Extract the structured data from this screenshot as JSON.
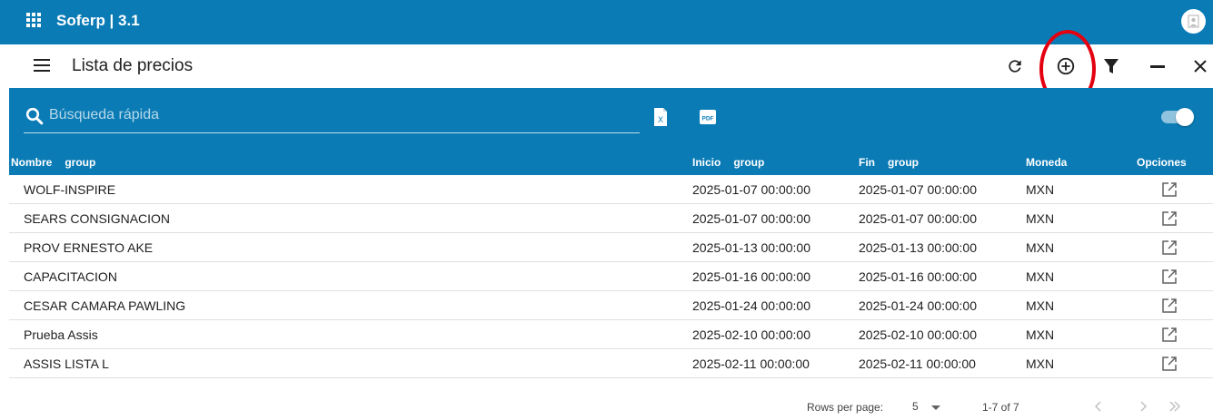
{
  "app": {
    "title": "Soferp | 3.1",
    "brand_color": "#0a7bb5",
    "icons": [
      "apps-grid-icon",
      "avatar-icon"
    ]
  },
  "toolbar": {
    "title": "Lista de precios",
    "icons": [
      "menu-icon",
      "refresh-icon",
      "add-circle-icon",
      "filter-icon",
      "minimize-icon",
      "close-icon"
    ]
  },
  "table_header": {
    "search_placeholder": "Búsqueda rápida",
    "export_buttons": [
      "excel-export-icon",
      "pdf-export-icon"
    ],
    "pdf_label": "PDF",
    "excel_label": "X",
    "toggle_on": true,
    "columns": [
      {
        "label": "Nombre",
        "group": "group"
      },
      {
        "label": "Inicio",
        "group": "group"
      },
      {
        "label": "Fin",
        "group": "group"
      },
      {
        "label": "Moneda",
        "group": ""
      },
      {
        "label": "Opciones",
        "group": ""
      }
    ]
  },
  "rows": [
    {
      "nombre": "WOLF-INSPIRE",
      "inicio": "2025-01-07 00:00:00",
      "fin": "2025-01-07 00:00:00",
      "moneda": "MXN"
    },
    {
      "nombre": "SEARS CONSIGNACION",
      "inicio": "2025-01-07 00:00:00",
      "fin": "2025-01-07 00:00:00",
      "moneda": "MXN"
    },
    {
      "nombre": "PROV ERNESTO AKE",
      "inicio": "2025-01-13 00:00:00",
      "fin": "2025-01-13 00:00:00",
      "moneda": "MXN"
    },
    {
      "nombre": "CAPACITACION",
      "inicio": "2025-01-16 00:00:00",
      "fin": "2025-01-16 00:00:00",
      "moneda": "MXN"
    },
    {
      "nombre": "CESAR CAMARA PAWLING",
      "inicio": "2025-01-24 00:00:00",
      "fin": "2025-01-24 00:00:00",
      "moneda": "MXN"
    },
    {
      "nombre": "Prueba Assis",
      "inicio": "2025-02-10 00:00:00",
      "fin": "2025-02-10 00:00:00",
      "moneda": "MXN"
    },
    {
      "nombre": "ASSIS LISTA L",
      "inicio": "2025-02-11 00:00:00",
      "fin": "2025-02-11 00:00:00",
      "moneda": "MXN"
    }
  ],
  "footer": {
    "rows_per_page_label": "Rows per page:",
    "rows_per_page_value": "5",
    "range": "1-7 of 7"
  },
  "annotation_color": "#e3000f"
}
